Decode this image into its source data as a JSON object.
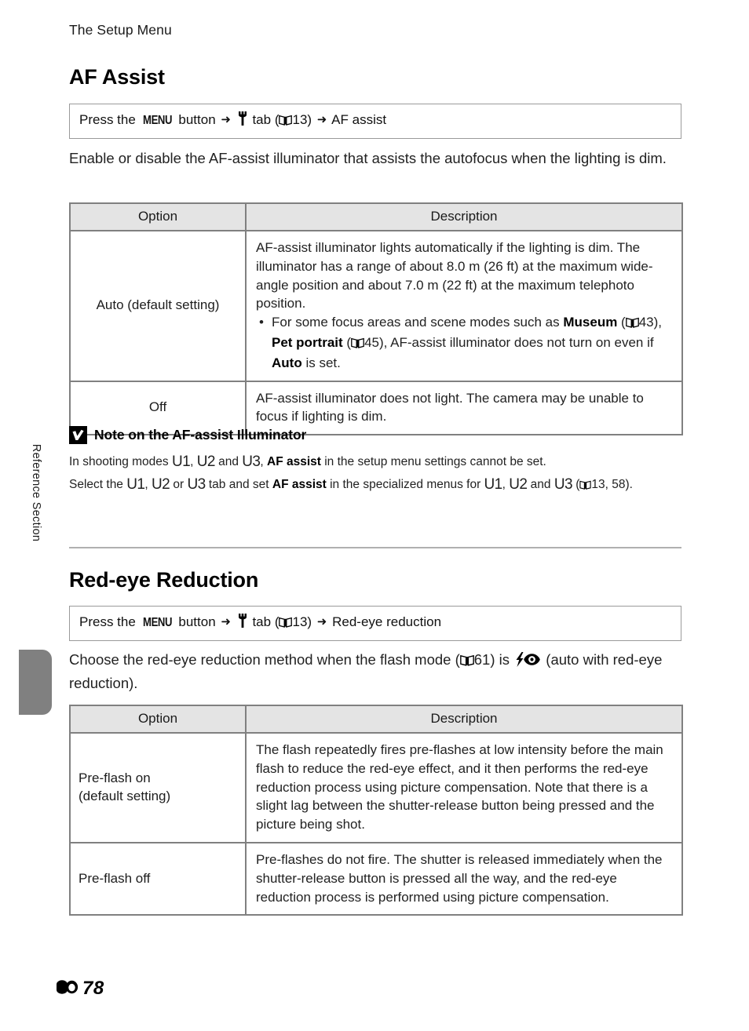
{
  "header": {
    "running_title": "The Setup Menu"
  },
  "sidebar": {
    "vertical_label": "Reference Section"
  },
  "footer": {
    "page_icon": "reference-section-icon",
    "page_number": "78"
  },
  "sections": [
    {
      "id": "af-assist",
      "title": "AF Assist",
      "path": {
        "prefix": "Press the",
        "menu_button": "MENU",
        "button_word": "button",
        "arrow": "➜",
        "tab_icon": "wrench-icon",
        "tab_word": "tab",
        "ref_open": "(",
        "book_icon": "book-icon",
        "ref_page": "13)",
        "arrow2": "➜",
        "target": "AF assist"
      },
      "intro": "Enable or disable the AF-assist illuminator that assists the autofocus when the lighting is dim.",
      "table": {
        "headers": [
          "Option",
          "Description"
        ],
        "rows": [
          {
            "option": "Auto (default setting)",
            "desc_paragraph": "AF-assist illuminator lights automatically if the lighting is dim. The illuminator has a range of about 8.0 m (26 ft) at the maximum wide-angle position and about 7.0 m (22 ft) at the maximum telephoto position.",
            "bullets": [
              {
                "parts": [
                  {
                    "t": "For some focus areas and scene modes such as "
                  },
                  {
                    "t": "Museum",
                    "bold": true
                  },
                  {
                    "t": " ("
                  },
                  {
                    "icon": "book-icon"
                  },
                  {
                    "t": "43), "
                  },
                  {
                    "t": "Pet portrait",
                    "bold": true
                  },
                  {
                    "t": " ("
                  },
                  {
                    "icon": "book-icon"
                  },
                  {
                    "t": "45), AF-assist illuminator does not turn on even if "
                  },
                  {
                    "t": "Auto",
                    "bold": true
                  },
                  {
                    "t": " is set."
                  }
                ]
              }
            ]
          },
          {
            "option": "Off",
            "desc_paragraph": "AF-assist illuminator does not light. The camera may be unable to focus if lighting is dim.",
            "bullets": []
          }
        ]
      },
      "note": {
        "icon": "note-warning-icon",
        "title": "Note on the AF-assist Illuminator",
        "line1_parts": [
          {
            "t": "In shooting modes "
          },
          {
            "t": "U1",
            "mode": true
          },
          {
            "t": ", "
          },
          {
            "t": "U2",
            "mode": true
          },
          {
            "t": " and "
          },
          {
            "t": "U3",
            "mode": true
          },
          {
            "t": ", "
          },
          {
            "t": "AF assist",
            "bold": true
          },
          {
            "t": " in the setup menu settings cannot be set."
          }
        ],
        "line2_parts": [
          {
            "t": "Select the "
          },
          {
            "t": "U1",
            "mode": true
          },
          {
            "t": ", "
          },
          {
            "t": "U2",
            "mode": true
          },
          {
            "t": " or "
          },
          {
            "t": "U3",
            "mode": true
          },
          {
            "t": " tab and set "
          },
          {
            "t": "AF assist",
            "bold": true
          },
          {
            "t": " in the specialized menus for "
          },
          {
            "t": "U1",
            "mode": true
          },
          {
            "t": ", "
          },
          {
            "t": "U2",
            "mode": true
          },
          {
            "t": " and "
          },
          {
            "t": "U3",
            "mode": true
          },
          {
            "t": " ("
          },
          {
            "icon": "book-icon"
          },
          {
            "t": "13, 58)."
          }
        ]
      }
    },
    {
      "id": "red-eye-reduction",
      "title": "Red-eye Reduction",
      "path": {
        "prefix": "Press the",
        "menu_button": "MENU",
        "button_word": "button",
        "arrow": "➜",
        "tab_icon": "wrench-icon",
        "tab_word": "tab",
        "ref_open": "(",
        "book_icon": "book-icon",
        "ref_page": "13)",
        "arrow2": "➜",
        "target": "Red-eye reduction"
      },
      "intro_parts": [
        {
          "t": "Choose the red-eye reduction method when the flash mode ("
        },
        {
          "icon": "book-icon"
        },
        {
          "t": "61) is "
        },
        {
          "icon": "flash-eye-icon"
        },
        {
          "t": " (auto with red-eye reduction)."
        }
      ],
      "table": {
        "headers": [
          "Option",
          "Description"
        ],
        "rows": [
          {
            "option": "Pre-flash on\n(default setting)",
            "desc_paragraph": "The flash repeatedly fires pre-flashes at low intensity before the main flash to reduce the red-eye effect, and it then performs the red-eye reduction process using picture compensation. Note that there is a slight lag between the shutter-release button being pressed and the picture being shot.",
            "bullets": []
          },
          {
            "option": "Pre-flash off",
            "desc_paragraph": "Pre-flashes do not fire. The shutter is released immediately when the shutter-release button is pressed all the way, and the red-eye reduction process is performed using picture compensation.",
            "bullets": []
          }
        ]
      }
    }
  ],
  "colors": {
    "table_header_bg": "#e4e4e4",
    "table_border": "#808080",
    "side_tab": "#808080",
    "rule": "#b0b0b0"
  }
}
